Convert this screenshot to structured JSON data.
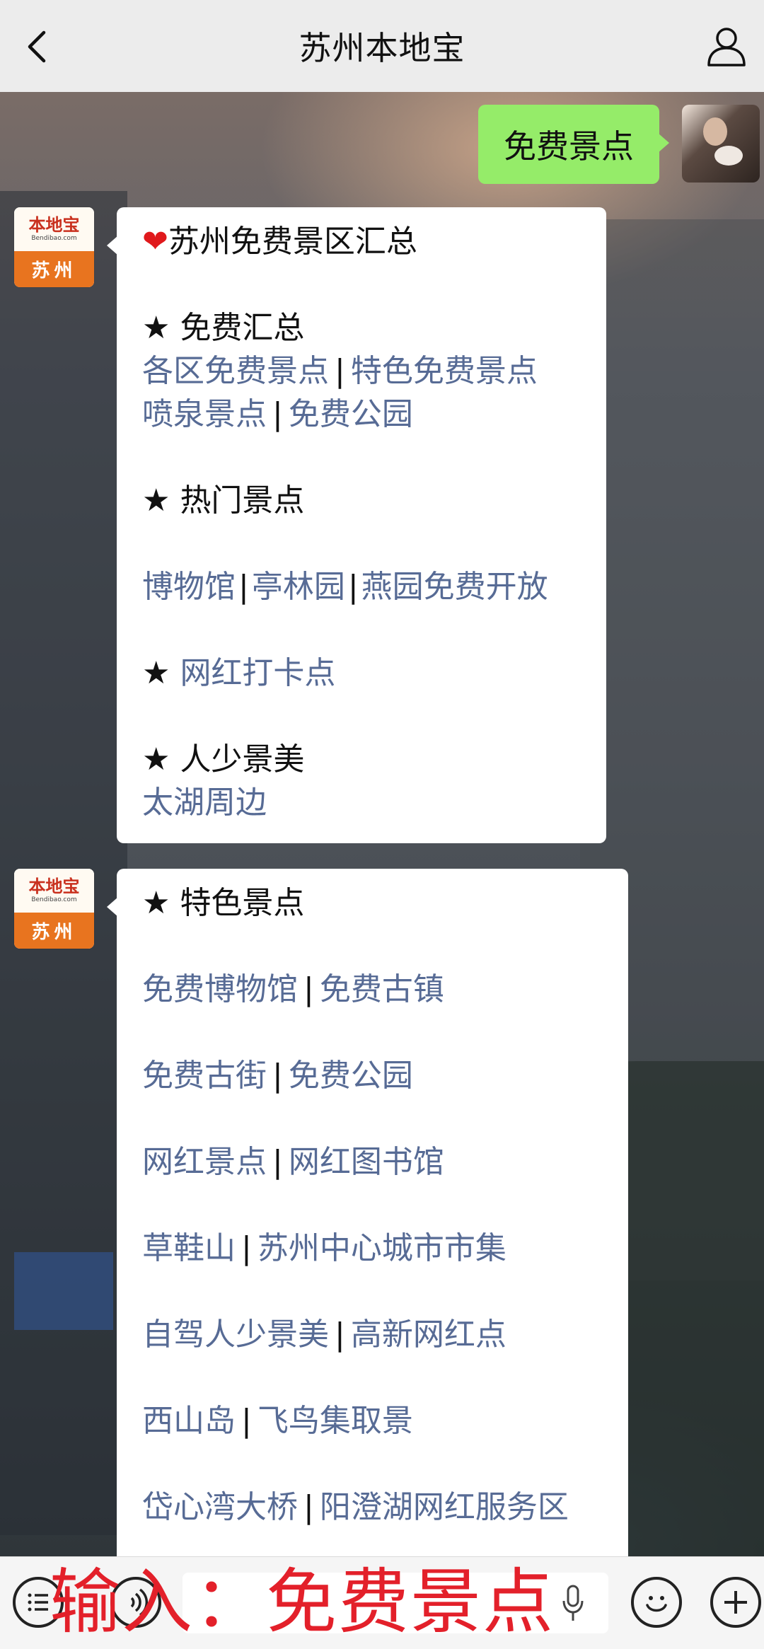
{
  "header": {
    "title": "苏州本地宝"
  },
  "self_message": {
    "text": "免费景点"
  },
  "bot_avatar": {
    "logo": "本地宝",
    "url": "Bendibao.com",
    "city": "苏州"
  },
  "msg1": {
    "title": "苏州免费景区汇总",
    "sec1": {
      "heading": "免费汇总",
      "links": [
        "各区免费景点",
        "特色免费景点",
        "喷泉景点",
        "免费公园"
      ]
    },
    "sec2": {
      "heading": "热门景点",
      "links": [
        "博物馆",
        "亭林园",
        "燕园免费开放"
      ]
    },
    "sec3": {
      "link": "网红打卡点"
    },
    "sec4": {
      "heading": "人少景美",
      "link": "太湖周边"
    }
  },
  "msg2": {
    "heading": "特色景点",
    "rows": [
      [
        "免费博物馆",
        "免费古镇"
      ],
      [
        "免费古街",
        "免费公园"
      ],
      [
        "网红景点",
        "网红图书馆"
      ],
      [
        "草鞋山",
        "苏州中心城市市集"
      ],
      [
        "自驾人少景美",
        "高新网红点"
      ],
      [
        "西山岛",
        "飞鸟集取景"
      ],
      [
        "岱心湾大桥",
        "阳澄湖网红服务区"
      ]
    ]
  },
  "overlay": {
    "text": "输入：免费景点"
  },
  "icons": [
    "back-icon",
    "person-icon",
    "menu-list-icon",
    "voice-icon",
    "mic-icon",
    "emoji-icon",
    "plus-icon",
    "heart-icon",
    "star-icon"
  ],
  "colors": {
    "link": "#576b95",
    "self_bubble": "#95ec69",
    "overlay": "#e3202a",
    "header_bg": "#ececec"
  }
}
